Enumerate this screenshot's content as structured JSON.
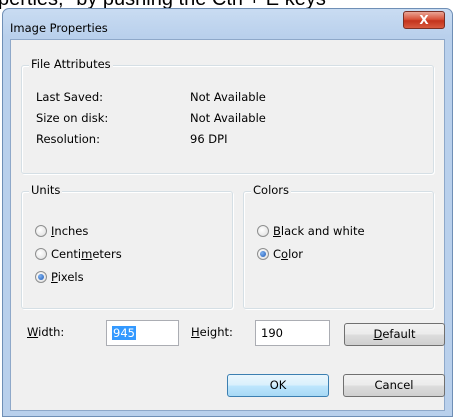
{
  "background_text": "perties,\" by pushing the Ctrl + E keys",
  "window": {
    "title": "Image Properties",
    "close_glyph": "X"
  },
  "file_attributes": {
    "legend": "File Attributes",
    "rows": [
      {
        "label": "Last Saved:",
        "value": "Not Available"
      },
      {
        "label": "Size on disk:",
        "value": "Not Available"
      },
      {
        "label": "Resolution:",
        "value": "96 DPI"
      }
    ]
  },
  "units": {
    "legend": "Units",
    "options": [
      {
        "pre": "",
        "mnemonic": "I",
        "post": "nches",
        "selected": false
      },
      {
        "pre": "Centi",
        "mnemonic": "m",
        "post": "eters",
        "selected": false
      },
      {
        "pre": "",
        "mnemonic": "P",
        "post": "ixels",
        "selected": true
      }
    ]
  },
  "colors": {
    "legend": "Colors",
    "options": [
      {
        "pre": "",
        "mnemonic": "B",
        "post": "lack and white",
        "selected": false
      },
      {
        "pre": "C",
        "mnemonic": "o",
        "post": "lor",
        "selected": true
      }
    ]
  },
  "size": {
    "width_label_mnemonic": "W",
    "width_label_rest": "idth:",
    "width_value": "945",
    "height_label_mnemonic": "H",
    "height_label_rest": "eight:",
    "height_value": "190"
  },
  "buttons": {
    "default_mnemonic": "D",
    "default_rest": "efault",
    "ok": "OK",
    "cancel": "Cancel"
  }
}
